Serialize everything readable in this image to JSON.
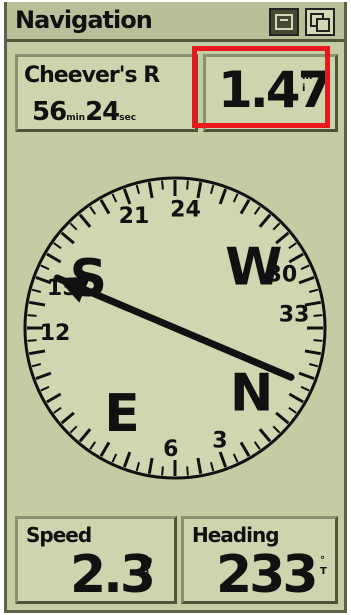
{
  "app": {
    "title": "Navigation"
  },
  "waypoint": {
    "name": "Cheever's R",
    "eta_minutes": "56",
    "eta_minutes_unit": "min",
    "eta_seconds": "24",
    "eta_seconds_unit": "sec"
  },
  "distance": {
    "value": "1.47",
    "unit": "mi"
  },
  "compass": {
    "cardinals": [
      "S",
      "W",
      "N",
      "E"
    ],
    "numbers": [
      "21",
      "24",
      "30",
      "33",
      "3",
      "6",
      "12",
      "15"
    ],
    "bearing_pointer_degrees": 293
  },
  "speed": {
    "label": "Speed",
    "value": "2.3",
    "unit": "mh"
  },
  "heading": {
    "label": "Heading",
    "value": "233",
    "unit": "°T"
  },
  "colors": {
    "screen": "#c3cca3",
    "ink": "#111111",
    "highlight": "#e8181c"
  }
}
